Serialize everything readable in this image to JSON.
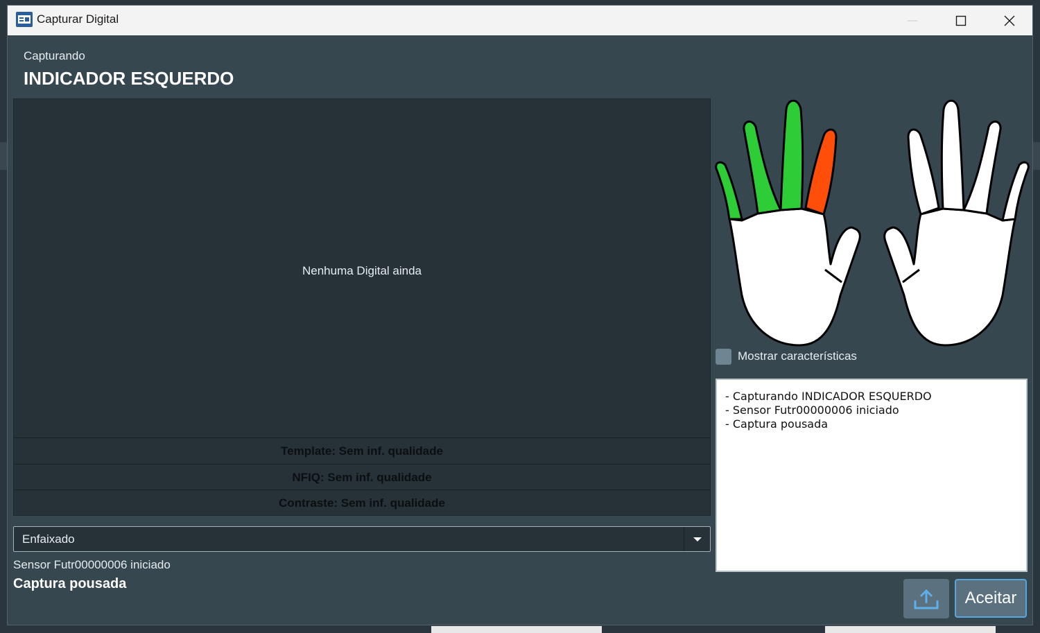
{
  "window": {
    "title": "Capturar Digital"
  },
  "header": {
    "subtitle": "Capturando",
    "finger_name": "INDICADOR ESQUERDO"
  },
  "preview": {
    "empty_text": "Nenhuma Digital ainda",
    "quality": {
      "template": "Template: Sem inf. qualidade",
      "nfiq": "NFIQ: Sem inf. qualidade",
      "contrast": "Contraste: Sem inf. qualidade"
    }
  },
  "capture_mode": {
    "selected": "Enfaixado"
  },
  "status": {
    "sensor": "Sensor Futr00000006 iniciado",
    "capture": "Captura pousada"
  },
  "hands": {
    "left_hand_finger_states": {
      "little": "captured",
      "ring": "captured",
      "middle": "captured",
      "index": "capturing",
      "thumb": "pending"
    },
    "right_hand_finger_states": {
      "thumb": "pending",
      "index": "pending",
      "middle": "pending",
      "ring": "pending",
      "little": "pending"
    },
    "colors": {
      "captured": "#2ecc36",
      "capturing": "#ff4d0a",
      "pending": "#ffffff"
    }
  },
  "options": {
    "show_features_label": "Mostrar características",
    "show_features_checked": false
  },
  "log": {
    "lines": [
      "- Capturando INDICADOR ESQUERDO",
      "- Sensor Futr00000006 iniciado",
      "- Captura pousada"
    ]
  },
  "actions": {
    "upload_icon": "upload-icon",
    "accept_label": "Aceitar"
  }
}
